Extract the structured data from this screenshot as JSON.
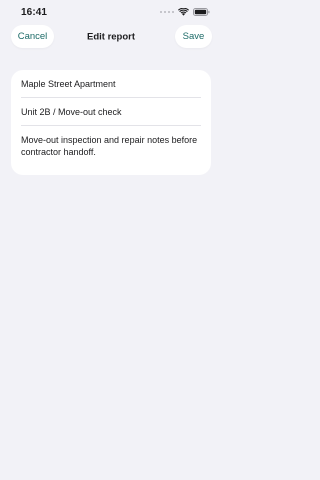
{
  "status_bar": {
    "time": "16:41"
  },
  "nav": {
    "cancel_label": "Cancel",
    "title": "Edit report",
    "save_label": "Save"
  },
  "form": {
    "property": "Maple Street Apartment",
    "unit": "Unit 2B / Move-out check",
    "notes": "Move-out inspection and repair notes before contractor handoff."
  },
  "colors": {
    "background": "#f2f2f7",
    "accent": "#1d6b68",
    "card": "#ffffff"
  },
  "icons": [
    "cellular-icon",
    "wifi-icon",
    "battery-icon"
  ]
}
